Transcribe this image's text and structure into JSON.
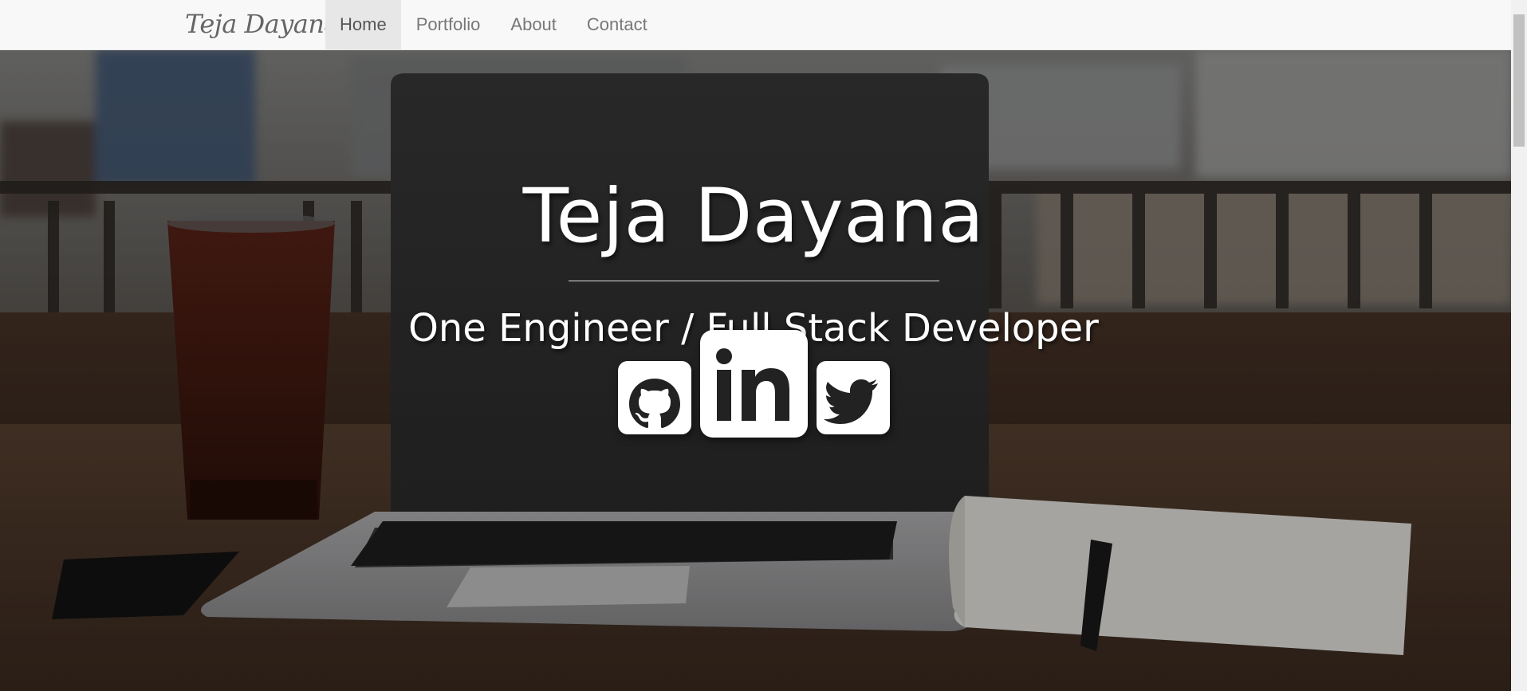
{
  "navbar": {
    "brand": "Teja Dayana",
    "items": [
      {
        "label": "Home",
        "active": true
      },
      {
        "label": "Portfolio",
        "active": false
      },
      {
        "label": "About",
        "active": false
      },
      {
        "label": "Contact",
        "active": false
      }
    ]
  },
  "hero": {
    "title": "Teja Dayana",
    "subtitle": "One Engineer / Full Stack Developer",
    "social": [
      {
        "name": "GitHub",
        "icon": "github-icon"
      },
      {
        "name": "LinkedIn",
        "icon": "linkedin-icon"
      },
      {
        "name": "Twitter",
        "icon": "twitter-icon"
      }
    ]
  },
  "colors": {
    "navbar_bg": "#f8f8f8",
    "active_tab_bg": "#e7e7e7",
    "nav_text": "#777777",
    "hero_text": "#ffffff"
  }
}
